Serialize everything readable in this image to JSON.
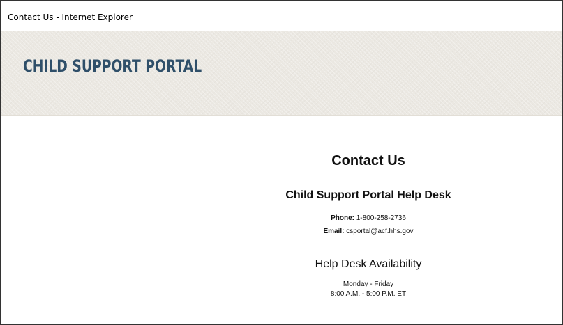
{
  "window": {
    "title": "Contact Us - Internet Explorer"
  },
  "header": {
    "logo_text": "CHILD SUPPORT PORTAL"
  },
  "main": {
    "title": "Contact Us",
    "helpdesk": {
      "heading": "Child Support Portal Help Desk",
      "phone_label": "Phone:",
      "phone_value": "1-800-258-2736",
      "email_label": "Email:",
      "email_value": "csportal@acf.hhs.gov"
    },
    "availability": {
      "heading": "Help Desk Availability",
      "days": "Monday - Friday",
      "hours": "8:00 A.M. - 5:00 P.M. ET"
    }
  }
}
